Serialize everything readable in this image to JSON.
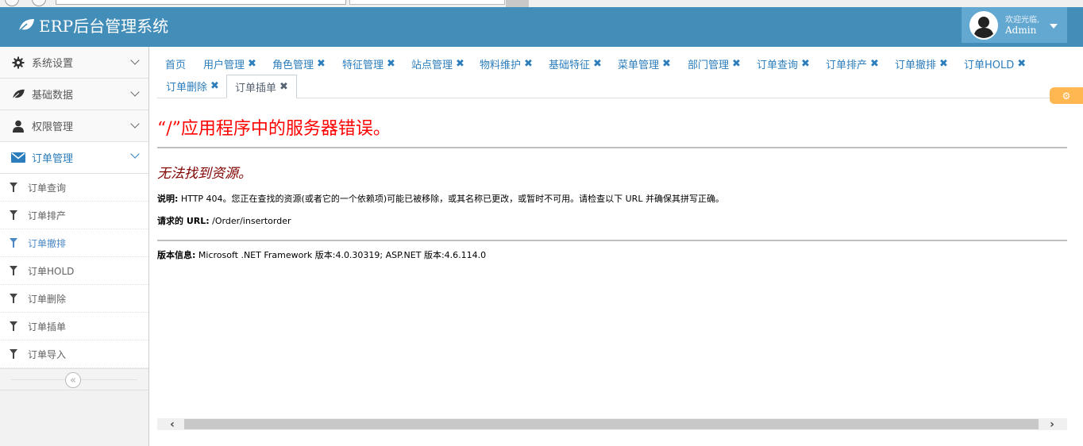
{
  "brand": {
    "title": "ERP后台管理系统",
    "icon": "leaf-icon"
  },
  "user": {
    "welcome": "欢迎光临,",
    "name": "Admin"
  },
  "sidebar": {
    "menus": [
      {
        "label": "系统设置",
        "icon": "gear-icon"
      },
      {
        "label": "基础数据",
        "icon": "leaf-icon"
      },
      {
        "label": "权限管理",
        "icon": "user-icon"
      },
      {
        "label": "订单管理",
        "icon": "envelope-icon"
      }
    ],
    "submenu": [
      {
        "label": "订单查询"
      },
      {
        "label": "订单排产"
      },
      {
        "label": "订单撤排"
      },
      {
        "label": "订单HOLD"
      },
      {
        "label": "订单删除"
      },
      {
        "label": "订单插单"
      },
      {
        "label": "订单导入"
      }
    ],
    "collapse_glyph": "«"
  },
  "tabs": [
    {
      "label": "首页"
    },
    {
      "label": "用户管理",
      "close": "✖"
    },
    {
      "label": "角色管理",
      "close": "✖"
    },
    {
      "label": "特征管理",
      "close": "✖"
    },
    {
      "label": "站点管理",
      "close": "✖"
    },
    {
      "label": "物料维护",
      "close": "✖"
    },
    {
      "label": "基础特征",
      "close": "✖"
    },
    {
      "label": "菜单管理",
      "close": "✖"
    },
    {
      "label": "部门管理",
      "close": "✖"
    },
    {
      "label": "订单查询",
      "close": "✖"
    },
    {
      "label": "订单排产",
      "close": "✖"
    },
    {
      "label": "订单撤排",
      "close": "✖"
    },
    {
      "label": "订单HOLD",
      "close": "✖"
    },
    {
      "label": "订单删除",
      "close": "✖"
    },
    {
      "label": "订单插单",
      "close": "✖"
    }
  ],
  "settings_glyph": "⚙",
  "error": {
    "title": "“/”应用程序中的服务器错误。",
    "subtitle": "无法找到资源。",
    "desc_label": "说明:",
    "desc_text": " HTTP 404。您正在查找的资源(或者它的一个依赖项)可能已被移除，或其名称已更改，或暂时不可用。请检查以下 URL 并确保其拼写正确。",
    "url_label": "请求的 URL:",
    "url_text": " /Order/insertorder",
    "version_label": "版本信息:",
    "version_text": " Microsoft .NET Framework 版本:4.0.30319; ASP.NET 版本:4.6.114.0"
  },
  "scroll": {
    "left": "‹",
    "right": "›"
  },
  "colors": {
    "navbar": "#438eb9",
    "accent": "#2b7dbc",
    "error_red": "#ff0000",
    "error_sub": "#800000",
    "settings": "#ffb752"
  }
}
